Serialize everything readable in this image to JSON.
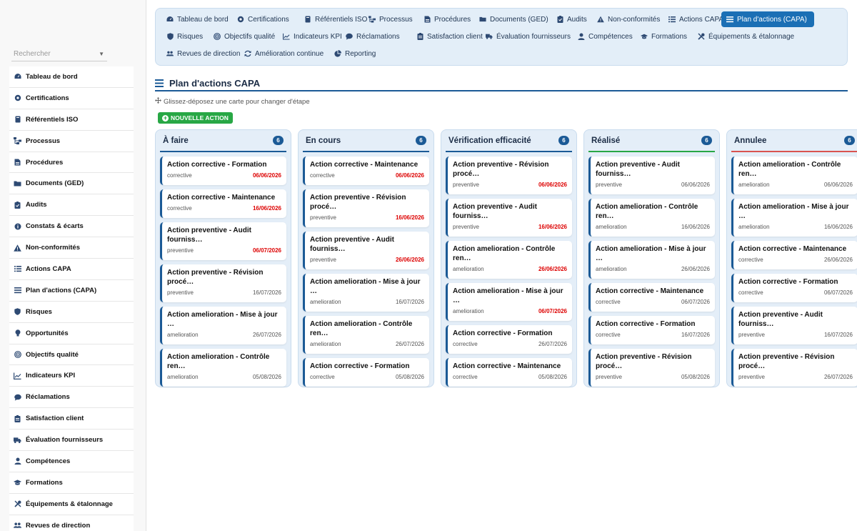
{
  "search": {
    "placeholder": "Rechercher"
  },
  "sidebar": {
    "items": [
      {
        "label": "Tableau de bord",
        "icon": "dashboard-icon"
      },
      {
        "label": "Certifications",
        "icon": "certificate-icon"
      },
      {
        "label": "Référentiels ISO",
        "icon": "book-icon"
      },
      {
        "label": "Processus",
        "icon": "sitemap-icon"
      },
      {
        "label": "Procédures",
        "icon": "file-icon"
      },
      {
        "label": "Documents (GED)",
        "icon": "folder-icon"
      },
      {
        "label": "Audits",
        "icon": "clipboard-icon"
      },
      {
        "label": "Constats & écarts",
        "icon": "info-icon"
      },
      {
        "label": "Non-conformités",
        "icon": "warning-icon"
      },
      {
        "label": "Actions CAPA",
        "icon": "list-icon"
      },
      {
        "label": "Plan d'actions (CAPA)",
        "icon": "bars-icon"
      },
      {
        "label": "Risques",
        "icon": "shield-icon"
      },
      {
        "label": "Opportunités",
        "icon": "lightbulb-icon"
      },
      {
        "label": "Objectifs qualité",
        "icon": "target-icon"
      },
      {
        "label": "Indicateurs KPI",
        "icon": "chart-line-icon"
      },
      {
        "label": "Réclamations",
        "icon": "comment-icon"
      },
      {
        "label": "Satisfaction client",
        "icon": "clipboard-check-icon"
      },
      {
        "label": "Évaluation fournisseurs",
        "icon": "truck-icon"
      },
      {
        "label": "Compétences",
        "icon": "user-badge-icon"
      },
      {
        "label": "Formations",
        "icon": "graduation-icon"
      },
      {
        "label": "Équipements & étalonnage",
        "icon": "tools-icon"
      },
      {
        "label": "Revues de direction",
        "icon": "users-icon"
      }
    ]
  },
  "topnav": {
    "items": [
      {
        "label": "Tableau de bord",
        "icon": "dashboard-icon"
      },
      {
        "label": "Certifications",
        "icon": "certificate-icon"
      },
      {
        "label": "Référentiels ISO",
        "icon": "book-icon"
      },
      {
        "label": "Processus",
        "icon": "sitemap-icon"
      },
      {
        "label": "Procédures",
        "icon": "file-icon"
      },
      {
        "label": "Documents (GED)",
        "icon": "folder-icon"
      },
      {
        "label": "Audits",
        "icon": "clipboard-icon"
      },
      {
        "label": "Non-conformités",
        "icon": "warning-icon"
      },
      {
        "label": "Actions CAPA",
        "icon": "list-icon"
      },
      {
        "label": "Plan d'actions (CAPA)",
        "icon": "bars-icon",
        "active": true
      },
      {
        "label": "Risques",
        "icon": "shield-icon"
      },
      {
        "label": "Objectifs qualité",
        "icon": "target-icon"
      },
      {
        "label": "Indicateurs KPI",
        "icon": "chart-line-icon"
      },
      {
        "label": "Réclamations",
        "icon": "comment-icon"
      },
      {
        "label": "Satisfaction client",
        "icon": "clipboard-check-icon"
      },
      {
        "label": "Évaluation fournisseurs",
        "icon": "truck-icon"
      },
      {
        "label": "Compétences",
        "icon": "user-badge-icon"
      },
      {
        "label": "Formations",
        "icon": "graduation-icon"
      },
      {
        "label": "Équipements & étalonnage",
        "icon": "tools-icon"
      },
      {
        "label": "Revues de direction",
        "icon": "users-icon"
      },
      {
        "label": "Amélioration continue",
        "icon": "sync-icon"
      },
      {
        "label": "Reporting",
        "icon": "pie-chart-icon"
      }
    ]
  },
  "page": {
    "title": "Plan d'actions CAPA",
    "hint": "Glissez-déposez une carte pour changer d'étape",
    "new_action": "NOUVELLE ACTION"
  },
  "colors": {
    "accent": "#1b5a96",
    "nav_active": "#1b6fb5",
    "late_date": "#dd0000",
    "new_button": "#28a745",
    "col_border_done": "#28a745",
    "col_border_cancelled": "#d9534f"
  },
  "columns": [
    {
      "title": "À faire",
      "count": "6",
      "accent": "#1b5a96",
      "cards": [
        {
          "title": "Action corrective - Formation",
          "type": "corrective",
          "date": "06/06/2026",
          "late": true
        },
        {
          "title": "Action corrective - Maintenance",
          "type": "corrective",
          "date": "16/06/2026",
          "late": true
        },
        {
          "title": "Action preventive - Audit fourniss…",
          "type": "preventive",
          "date": "06/07/2026",
          "late": true
        },
        {
          "title": "Action preventive - Révision procé…",
          "type": "preventive",
          "date": "16/07/2026",
          "late": false
        },
        {
          "title": "Action amelioration - Mise à jour …",
          "type": "amelioration",
          "date": "26/07/2026",
          "late": false
        },
        {
          "title": "Action amelioration - Contrôle ren…",
          "type": "amelioration",
          "date": "05/08/2026",
          "late": false
        }
      ]
    },
    {
      "title": "En cours",
      "count": "6",
      "accent": "#1b5a96",
      "cards": [
        {
          "title": "Action corrective - Maintenance",
          "type": "corrective",
          "date": "06/06/2026",
          "late": true
        },
        {
          "title": "Action preventive - Révision procé…",
          "type": "preventive",
          "date": "16/06/2026",
          "late": true
        },
        {
          "title": "Action preventive - Audit fourniss…",
          "type": "preventive",
          "date": "26/06/2026",
          "late": true
        },
        {
          "title": "Action amelioration - Mise à jour …",
          "type": "amelioration",
          "date": "16/07/2026",
          "late": false
        },
        {
          "title": "Action amelioration - Contrôle ren…",
          "type": "amelioration",
          "date": "26/07/2026",
          "late": false
        },
        {
          "title": "Action corrective - Formation",
          "type": "corrective",
          "date": "05/08/2026",
          "late": false
        }
      ]
    },
    {
      "title": "Vérification efficacité",
      "count": "6",
      "accent": "#1b5a96",
      "cards": [
        {
          "title": "Action preventive - Révision procé…",
          "type": "preventive",
          "date": "06/06/2026",
          "late": true
        },
        {
          "title": "Action preventive - Audit fourniss…",
          "type": "preventive",
          "date": "16/06/2026",
          "late": true
        },
        {
          "title": "Action amelioration - Contrôle ren…",
          "type": "amelioration",
          "date": "26/06/2026",
          "late": true
        },
        {
          "title": "Action amelioration - Mise à jour …",
          "type": "amelioration",
          "date": "06/07/2026",
          "late": true
        },
        {
          "title": "Action corrective - Formation",
          "type": "corrective",
          "date": "26/07/2026",
          "late": false
        },
        {
          "title": "Action corrective - Maintenance",
          "type": "corrective",
          "date": "05/08/2026",
          "late": false
        }
      ]
    },
    {
      "title": "Réalisé",
      "count": "6",
      "accent": "#28a745",
      "cards": [
        {
          "title": "Action preventive - Audit fourniss…",
          "type": "preventive",
          "date": "06/06/2026",
          "late": false
        },
        {
          "title": "Action amelioration - Contrôle ren…",
          "type": "amelioration",
          "date": "16/06/2026",
          "late": false
        },
        {
          "title": "Action amelioration - Mise à jour …",
          "type": "amelioration",
          "date": "26/06/2026",
          "late": false
        },
        {
          "title": "Action corrective - Maintenance",
          "type": "corrective",
          "date": "06/07/2026",
          "late": false
        },
        {
          "title": "Action corrective - Formation",
          "type": "corrective",
          "date": "16/07/2026",
          "late": false
        },
        {
          "title": "Action preventive - Révision procé…",
          "type": "preventive",
          "date": "05/08/2026",
          "late": false
        }
      ]
    },
    {
      "title": "Annulee",
      "count": "6",
      "accent": "#d9534f",
      "cards": [
        {
          "title": "Action amelioration - Contrôle ren…",
          "type": "amelioration",
          "date": "06/06/2026",
          "late": false
        },
        {
          "title": "Action amelioration - Mise à jour …",
          "type": "amelioration",
          "date": "16/06/2026",
          "late": false
        },
        {
          "title": "Action corrective - Maintenance",
          "type": "corrective",
          "date": "26/06/2026",
          "late": false
        },
        {
          "title": "Action corrective - Formation",
          "type": "corrective",
          "date": "06/07/2026",
          "late": false
        },
        {
          "title": "Action preventive - Audit fourniss…",
          "type": "preventive",
          "date": "16/07/2026",
          "late": false
        },
        {
          "title": "Action preventive - Révision procé…",
          "type": "preventive",
          "date": "26/07/2026",
          "late": false
        }
      ]
    }
  ]
}
